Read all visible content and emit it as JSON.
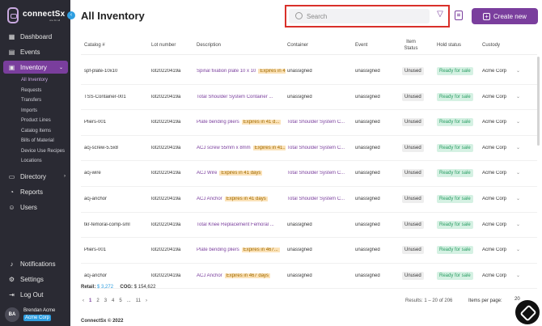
{
  "app": {
    "logo_text": "connectSx",
    "logo_tag": "one for all",
    "collapse_icon": "chevron-left-icon"
  },
  "nav": {
    "dashboard": "Dashboard",
    "events": "Events",
    "inventory": "Inventory",
    "inventory_sub": [
      "All Inventory",
      "Requests",
      "Transfers",
      "Imports",
      "Product Lines",
      "Catalog Items",
      "Bills of Material",
      "Device Use Recipes",
      "Locations"
    ],
    "directory": "Directory",
    "reports": "Reports",
    "users": "Users",
    "notifications": "Notifications",
    "settings": "Settings",
    "logout": "Log Out"
  },
  "user": {
    "initials": "BA",
    "name": "Brendan Acme",
    "org": "Acme Corp"
  },
  "header": {
    "title": "All Inventory",
    "search_placeholder": "Search",
    "create_label": "Create new"
  },
  "table": {
    "columns": [
      "Catalog #",
      "Lot number",
      "Description",
      "Container",
      "Event",
      "Item Status",
      "Hold status",
      "Custody"
    ],
    "rows": [
      {
        "catalog": "spf-plate-10x10",
        "lot": "lot20220419a",
        "desc": "Spinal fixation plate 10 x 10",
        "expires": "Expires in 467...",
        "container": "unassigned",
        "event": "unassigned",
        "status": "Unused",
        "hold": "Ready for sale",
        "custody": "Acme Corp"
      },
      {
        "catalog": "TSS-Container-001",
        "lot": "lot20220419a",
        "desc": "Total Shoulder System Container ...",
        "expires": "",
        "container": "unassigned",
        "event": "unassigned",
        "status": "Unused",
        "hold": "Ready for sale",
        "custody": "Acme Corp"
      },
      {
        "catalog": "Pliers-001",
        "lot": "lot20220419a",
        "desc": "Plate bending pliers",
        "expires": "Expires in 41 d...",
        "container": "Total Shoulder System C...",
        "event": "unassigned",
        "status": "Unused",
        "hold": "Ready for sale",
        "custody": "Acme Corp"
      },
      {
        "catalog": "acj-screw-5.5x8",
        "lot": "lot20220419a",
        "desc": "ACJ screw 55mm x 8mm",
        "expires": "Expires in 41...",
        "container": "Total Shoulder System C...",
        "event": "unassigned",
        "status": "Unused",
        "hold": "Ready for sale",
        "custody": "Acme Corp"
      },
      {
        "catalog": "acj-wire",
        "lot": "lot20220419a",
        "desc": "ACJ Wire",
        "expires": "Expires in 41 days",
        "container": "Total Shoulder System C...",
        "event": "unassigned",
        "status": "Unused",
        "hold": "Ready for sale",
        "custody": "Acme Corp"
      },
      {
        "catalog": "acj-anchor",
        "lot": "lot20220419a",
        "desc": "ACJ Anchor",
        "expires": "Expires in 41 days",
        "container": "Total Shoulder System C...",
        "event": "unassigned",
        "status": "Unused",
        "hold": "Ready for sale",
        "custody": "Acme Corp"
      },
      {
        "catalog": "tkr-femoral-comp-sml",
        "lot": "lot20220419a",
        "desc": "Total Knee Replacement Femoral ...",
        "expires": "",
        "container": "unassigned",
        "event": "unassigned",
        "status": "Unused",
        "hold": "Ready for sale",
        "custody": "Acme Corp"
      },
      {
        "catalog": "Pliers-001",
        "lot": "lot20220419a",
        "desc": "Plate bending pliers",
        "expires": "Expires in 467...",
        "container": "unassigned",
        "event": "unassigned",
        "status": "Unused",
        "hold": "Ready for sale",
        "custody": "Acme Corp"
      },
      {
        "catalog": "acj-anchor",
        "lot": "lot20220419a",
        "desc": "ACJ Anchor",
        "expires": "Expires in 467 days",
        "container": "unassigned",
        "event": "unassigned",
        "status": "Unused",
        "hold": "Ready for sale",
        "custody": "Acme Corp"
      }
    ]
  },
  "totals": {
    "retail_label": "Retail:",
    "retail_value": "$ 3,272",
    "cog_label": "COG:",
    "cog_value": "$ 154,622"
  },
  "pagination": {
    "prev": "‹",
    "pages": [
      "1",
      "2",
      "3",
      "4",
      "5",
      "...",
      "11"
    ],
    "active_page": "1",
    "next": "›",
    "results": "Results: 1 – 20 of 206",
    "per_page_label": "Items per page:",
    "per_page_value": "20"
  },
  "footer": "ConnectSx © 2022"
}
